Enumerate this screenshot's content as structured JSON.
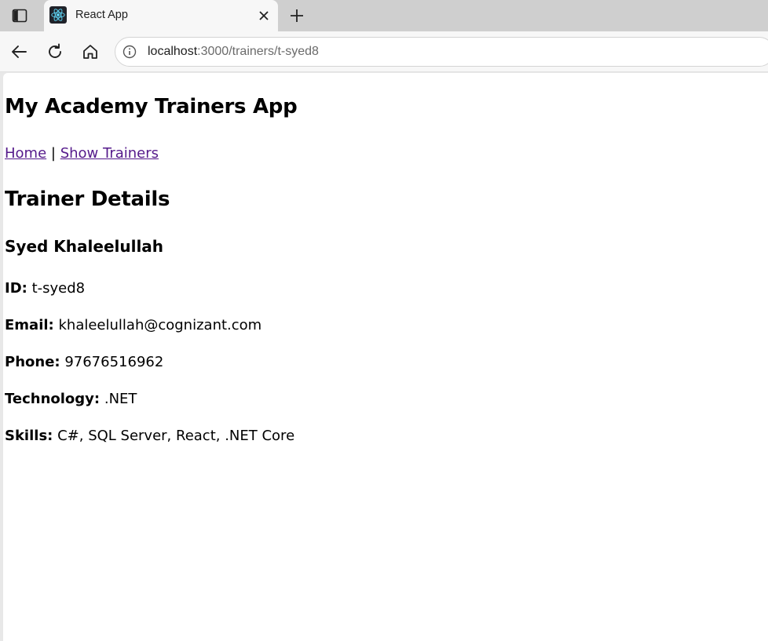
{
  "browser": {
    "tab": {
      "title": "React App"
    },
    "address": {
      "host": "localhost",
      "path": ":3000/trainers/t-syed8"
    }
  },
  "app": {
    "title": "My Academy Trainers App",
    "nav": {
      "home": "Home",
      "separator": "|",
      "trainers": "Show Trainers"
    }
  },
  "details": {
    "heading": "Trainer Details",
    "name": "Syed Khaleelullah",
    "fields": [
      {
        "label": "ID:",
        "value": "t-syed8"
      },
      {
        "label": "Email:",
        "value": "khaleelullah@cognizant.com"
      },
      {
        "label": "Phone:",
        "value": "97676516962"
      },
      {
        "label": "Technology:",
        "value": ".NET"
      },
      {
        "label": "Skills:",
        "value": "C#, SQL Server, React, .NET Core"
      }
    ]
  },
  "icons": {
    "sidebar": "sidebar-icon",
    "favicon": "react-logo-icon",
    "close": "close-icon",
    "new_tab": "plus-icon",
    "back": "back-arrow-icon",
    "reload": "reload-icon",
    "home": "home-icon",
    "info": "info-icon"
  },
  "colors": {
    "link": "#551a8b",
    "favicon_bg": "#20232a",
    "react": "#61dafb"
  }
}
